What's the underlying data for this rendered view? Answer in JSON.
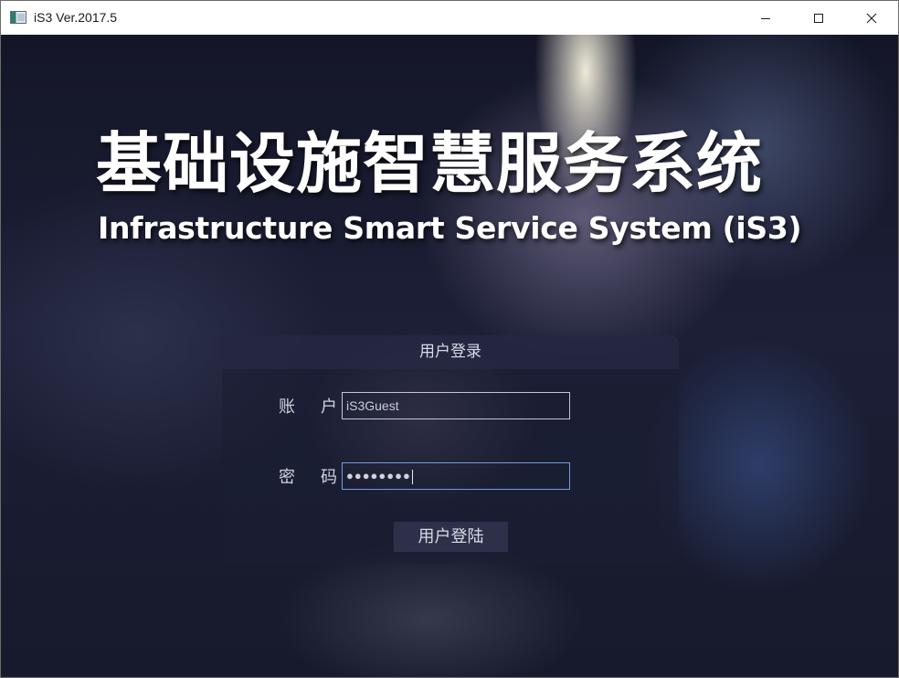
{
  "window": {
    "title": "iS3 Ver.2017.5",
    "controls": {
      "minimize_icon": "minimize-icon",
      "maximize_icon": "maximize-icon",
      "close_icon": "close-icon"
    }
  },
  "hero": {
    "title_cn": "基础设施智慧服务系统",
    "title_en": "Infrastructure Smart Service System (iS3)"
  },
  "login": {
    "header": "用户登录",
    "account_label_1": "账",
    "account_label_2": "户",
    "account_value": "iS3Guest",
    "password_label_1": "密",
    "password_label_2": "码",
    "password_value_masked": "●●●●●●●●",
    "submit_label": "用户登陆"
  },
  "colors": {
    "panel_bg": "#1c1e34",
    "input_border": "#c4c8d4",
    "focused_input_border": "#6f9fe0",
    "text": "#d8dce8"
  }
}
